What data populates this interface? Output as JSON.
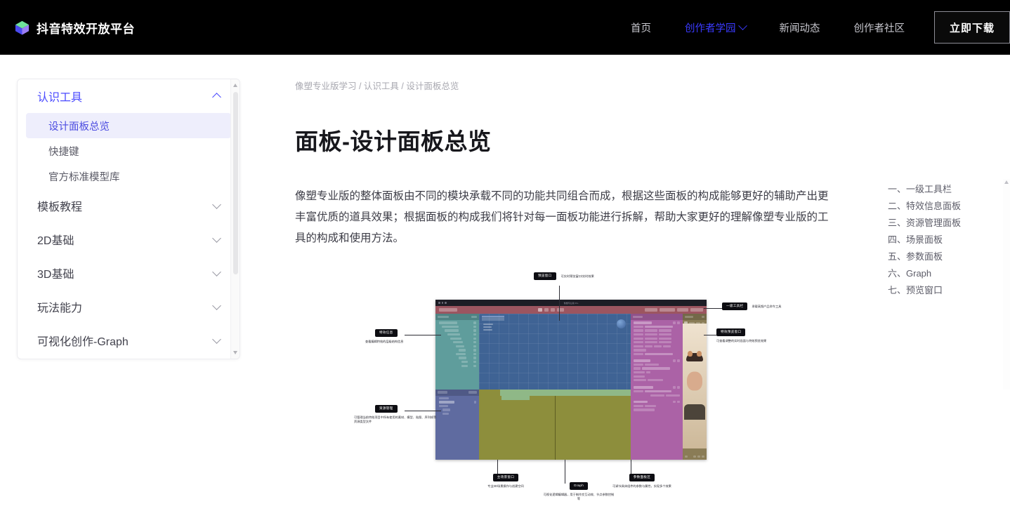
{
  "header": {
    "brand": "抖音特效开放平台",
    "logo_icon": "cube-logo-icon",
    "nav": [
      {
        "label": "首页",
        "active": false,
        "has_chevron": false
      },
      {
        "label": "创作者学园",
        "active": true,
        "has_chevron": true
      },
      {
        "label": "新闻动态",
        "active": false,
        "has_chevron": false
      },
      {
        "label": "创作者社区",
        "active": false,
        "has_chevron": false
      }
    ],
    "download_label": "立即下载",
    "bg_color": "#000000",
    "active_color": "#3a3aff"
  },
  "sidebar": {
    "scrollbar": {
      "up_icon": "chevron-up-icon",
      "down_icon": "chevron-down-icon"
    },
    "groups": [
      {
        "label": "认识工具",
        "expanded": true,
        "items": [
          {
            "label": "设计面板总览",
            "active": true
          },
          {
            "label": "快捷键",
            "active": false
          },
          {
            "label": "官方标准模型库",
            "active": false
          }
        ]
      },
      {
        "label": "模板教程",
        "expanded": false,
        "items": []
      },
      {
        "label": "2D基础",
        "expanded": false,
        "items": []
      },
      {
        "label": "3D基础",
        "expanded": false,
        "items": []
      },
      {
        "label": "玩法能力",
        "expanded": false,
        "items": []
      },
      {
        "label": "可视化创作-Graph",
        "expanded": false,
        "items": []
      }
    ]
  },
  "main": {
    "breadcrumb": "像塑专业版学习 / 认识工具 / 设计面板总览",
    "title": "面板-设计面板总览",
    "paragraph": "像塑专业版的整体面板由不同的模块承载不同的功能共同组合而成，根据这些面板的构成能够更好的辅助产出更丰富优质的道具效果；根据面板的构成我们将针对每一面板功能进行拆解，帮助大家更好的理解像塑专业版的工具的构成和使用方法。",
    "figure": {
      "alt": "像塑专业版设计面板总览示意图",
      "app_window_title": "像塑专业版 Pro",
      "callouts": [
        {
          "tag": "预览窗口",
          "desc": "可实时预览窗口/实时效果",
          "position": "top"
        },
        {
          "tag": "特效信息",
          "desc": "查看编辑特效的层级结构信息",
          "position": "left-top"
        },
        {
          "tag": "资源管理",
          "desc": "可管理当前特效项目中所有使用的素材、模型、贴图、序列帧等资源类型文件",
          "position": "left-bottom"
        },
        {
          "tag": "一级工具栏",
          "desc": "承载高频产品命令工具",
          "position": "right-top"
        },
        {
          "tag": "特效预览窗口",
          "desc": "可查看调整的实时画面与特效预览效果",
          "position": "right-mid"
        },
        {
          "tag": "主场景窗口",
          "desc": "专业3D场景操作与创建空间",
          "position": "bottom-left"
        },
        {
          "tag": "Graph",
          "desc": "可视化逻辑编辑器，用于制作交互动效、节点参数控制等",
          "position": "bottom-mid"
        },
        {
          "tag": "参数面板区",
          "desc": "可调节具体组件的参数与属性，实现多个效果",
          "position": "bottom-right"
        }
      ]
    }
  },
  "toc": {
    "scroll_up_icon": "chevron-up-icon",
    "items": [
      {
        "label": "一、一级工具栏"
      },
      {
        "label": "二、特效信息面板"
      },
      {
        "label": "三、资源管理面板"
      },
      {
        "label": "四、场景面板"
      },
      {
        "label": "五、参数面板"
      },
      {
        "label": "六、Graph"
      },
      {
        "label": "七、预览窗口"
      }
    ]
  }
}
